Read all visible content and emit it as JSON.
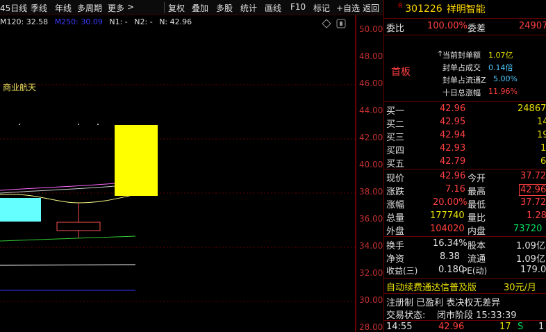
{
  "toolbar": {
    "items": [
      "45日线",
      "季线",
      "年线",
      "多周期",
      "更多",
      "复权",
      "叠加",
      "多股",
      "统计",
      "画线",
      "F10",
      "标记",
      "+自选",
      "返回"
    ],
    "more_arrow": ">"
  },
  "chart": {
    "ma_legend": {
      "m120": "M120: 32.58",
      "m250": "M250: 30.09",
      "n1": "N1: -",
      "n2": "N2: -",
      "n": "N: 42.96"
    },
    "sector": "商业航天",
    "price_ticks": [
      "50.00",
      "48.00",
      "46.00",
      "44.00",
      "42.00",
      "40.00",
      "38.00",
      "36.00",
      "34.00",
      "32.00",
      "30.00",
      "28.00"
    ],
    "colors": {
      "up": "#ffff00",
      "cyan_box": "#66ffff",
      "ma1": "#ff66ff",
      "ma2": "#ffff88",
      "ma3": "#33cc33",
      "ma4": "#ffffff",
      "ma5": "#3333ff"
    }
  },
  "stock": {
    "flag": "R",
    "code": "301226",
    "name": "祥明智能",
    "weibi_label": "委比",
    "weibi": "100.00%",
    "weicha_label": "委差",
    "weicha": "24907",
    "board": "首板",
    "stats": [
      {
        "label": "当前封单额",
        "value": "1.07亿",
        "icon": "↑"
      },
      {
        "label": "封单占成交",
        "value": "0.14倍"
      },
      {
        "label": "封单占流通Z",
        "value": "5.00%"
      },
      {
        "label": "十日总涨幅",
        "value": "11.96%"
      }
    ],
    "bids": [
      {
        "label": "买一",
        "price": "42.96",
        "vol": "24867"
      },
      {
        "label": "买二",
        "price": "42.95",
        "vol": "14"
      },
      {
        "label": "买三",
        "price": "42.94",
        "vol": "19"
      },
      {
        "label": "买四",
        "price": "42.93",
        "vol": "1"
      },
      {
        "label": "买五",
        "price": "42.79",
        "vol": "6"
      }
    ],
    "quote": [
      {
        "l1": "现价",
        "v1": "42.96",
        "l2": "今开",
        "v2": "37.72"
      },
      {
        "l1": "涨跌",
        "v1": "7.16",
        "l2": "最高",
        "v2": "42.96"
      },
      {
        "l1": "涨幅",
        "v1": "20.00%",
        "l2": "最低",
        "v2": "37.72"
      },
      {
        "l1": "总量",
        "v1": "177740",
        "l2": "量比",
        "v2": "1.28"
      },
      {
        "l1": "外盘",
        "v1": "104020",
        "l2": "内盘",
        "v2": "73720"
      }
    ],
    "fund": [
      {
        "l1": "换手",
        "v1": "16.34%",
        "l2": "股本",
        "v2": "1.09亿"
      },
      {
        "l1": "净资",
        "v1": "8.38",
        "l2": "流通",
        "v2": "1.09亿"
      },
      {
        "l1": "收益(三)",
        "v1": "0.180",
        "l2": "PE(动)",
        "v2": "179.0"
      }
    ],
    "promo": "自动续费通达信普及版",
    "promo_price": "30元/月",
    "reg": "注册制 已盈利 表决权无差异",
    "status_label": "交易状态:",
    "status": "闭市阶段 15:33:39",
    "tick": {
      "time": "14:55",
      "price": "42.96",
      "vol": "17",
      "side": "S",
      "count": "1"
    }
  }
}
